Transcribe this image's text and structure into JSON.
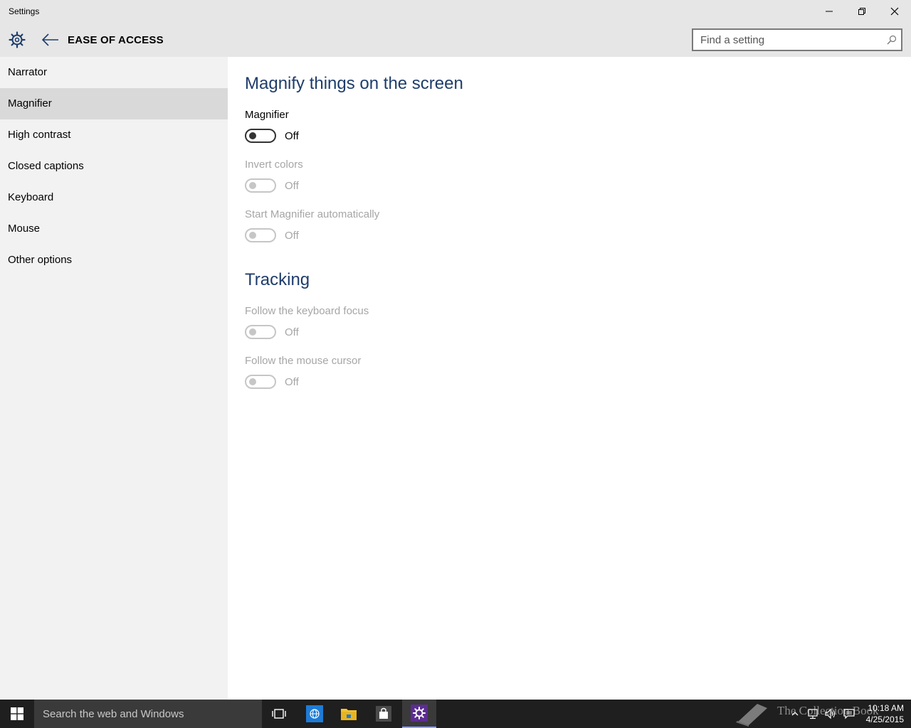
{
  "window": {
    "title": "Settings"
  },
  "header": {
    "section_title": "EASE OF ACCESS",
    "search_placeholder": "Find a setting"
  },
  "sidebar": {
    "items": [
      {
        "label": "Narrator",
        "selected": false
      },
      {
        "label": "Magnifier",
        "selected": true
      },
      {
        "label": "High contrast",
        "selected": false
      },
      {
        "label": "Closed captions",
        "selected": false
      },
      {
        "label": "Keyboard",
        "selected": false
      },
      {
        "label": "Mouse",
        "selected": false
      },
      {
        "label": "Other options",
        "selected": false
      }
    ]
  },
  "main": {
    "heading": "Magnify things on the screen",
    "settings": [
      {
        "label": "Magnifier",
        "state": "Off",
        "enabled": true
      },
      {
        "label": "Invert colors",
        "state": "Off",
        "enabled": false
      },
      {
        "label": "Start Magnifier automatically",
        "state": "Off",
        "enabled": false
      }
    ],
    "tracking_heading": "Tracking",
    "tracking_settings": [
      {
        "label": "Follow the keyboard focus",
        "state": "Off",
        "enabled": false
      },
      {
        "label": "Follow the mouse cursor",
        "state": "Off",
        "enabled": false
      }
    ]
  },
  "taskbar": {
    "search_placeholder": "Search the web and Windows",
    "watermark": "The Collection Book",
    "time": "10:18 AM",
    "date": "4/25/2015"
  },
  "colors": {
    "heading": "#1f3d6b",
    "sidebar_bg": "#f2f2f2",
    "selected_bg": "#d9d9d9",
    "titlebar_bg": "#e6e6e6",
    "taskbar_bg": "#1f1f1f",
    "disabled_text": "#a6a6a6"
  }
}
